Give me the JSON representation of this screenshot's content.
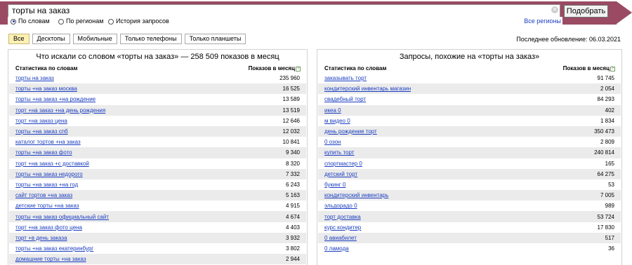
{
  "search": {
    "query": "торты на заказ",
    "submit_label": "Подобрать",
    "clear_icon": "close-icon"
  },
  "modes": {
    "by_words": "По словам",
    "by_regions": "По регионам",
    "history": "История запросов",
    "all_regions": "Все регионы"
  },
  "tabs": [
    "Все",
    "Десктопы",
    "Мобильные",
    "Только телефоны",
    "Только планшеты"
  ],
  "last_update": "Последнее обновление: 06.03.2021",
  "left": {
    "title": "Что искали со словом «торты на заказ» — 258 509 показов в месяц",
    "col_words": "Статистика по словам",
    "col_shows": "Показов в месяц",
    "rows": [
      {
        "q": "торты на заказ",
        "n": "235 960"
      },
      {
        "q": "торты +на заказ москва",
        "n": "16 525"
      },
      {
        "q": "торты +на заказ +на рождение",
        "n": "13 589"
      },
      {
        "q": "торт +на заказ +на день рождения",
        "n": "13 519"
      },
      {
        "q": "торт +на заказ цена",
        "n": "12 646"
      },
      {
        "q": "торты +на заказ спб",
        "n": "12 032"
      },
      {
        "q": "каталог тортов +на заказ",
        "n": "10 841"
      },
      {
        "q": "торты +на заказ фото",
        "n": "9 340"
      },
      {
        "q": "торт +на заказ +с доставкой",
        "n": "8 320"
      },
      {
        "q": "торты +на заказ недорого",
        "n": "7 332"
      },
      {
        "q": "торты +на заказ +на год",
        "n": "6 243"
      },
      {
        "q": "сайт тортов +на заказ",
        "n": "5 163"
      },
      {
        "q": "детские торты +на заказ",
        "n": "4 915"
      },
      {
        "q": "торты +на заказ официальный сайт",
        "n": "4 674"
      },
      {
        "q": "торт +на заказ фото цена",
        "n": "4 403"
      },
      {
        "q": "торт +в день заказа",
        "n": "3 932"
      },
      {
        "q": "торты +на заказ екатеринбург",
        "n": "3 802"
      },
      {
        "q": "домашние торты +на заказ",
        "n": "2 944"
      }
    ]
  },
  "right": {
    "title": "Запросы, похожие на «торты на заказ»",
    "col_words": "Статистика по словам",
    "col_shows": "Показов в месяц",
    "rows": [
      {
        "q": "заказывать торт",
        "n": "91 745"
      },
      {
        "q": "кондитерский инвентарь магазин",
        "n": "2 054"
      },
      {
        "q": "свадебный торт",
        "n": "84 293"
      },
      {
        "q": "икеа 0",
        "n": "402"
      },
      {
        "q": "м видео 0",
        "n": "1 834"
      },
      {
        "q": "день рождение торт",
        "n": "350 473"
      },
      {
        "q": "0 озон",
        "n": "2 809"
      },
      {
        "q": "купить торт",
        "n": "240 814"
      },
      {
        "q": "спортмастер 0",
        "n": "165"
      },
      {
        "q": "детский торт",
        "n": "64 275"
      },
      {
        "q": "букинг 0",
        "n": "53"
      },
      {
        "q": "кондитерский инвентарь",
        "n": "7 005"
      },
      {
        "q": "эльдорадо 0",
        "n": "989"
      },
      {
        "q": "торт доставка",
        "n": "53 724"
      },
      {
        "q": "курс кондитер",
        "n": "17 830"
      },
      {
        "q": "0 авиабилет",
        "n": "517"
      },
      {
        "q": "0 ламода",
        "n": "36"
      }
    ]
  },
  "colors": {
    "band": "#9a4b63",
    "link": "#1a3dc1",
    "active_tab": "#fdf0b4",
    "row_alt": "#ebebeb"
  }
}
